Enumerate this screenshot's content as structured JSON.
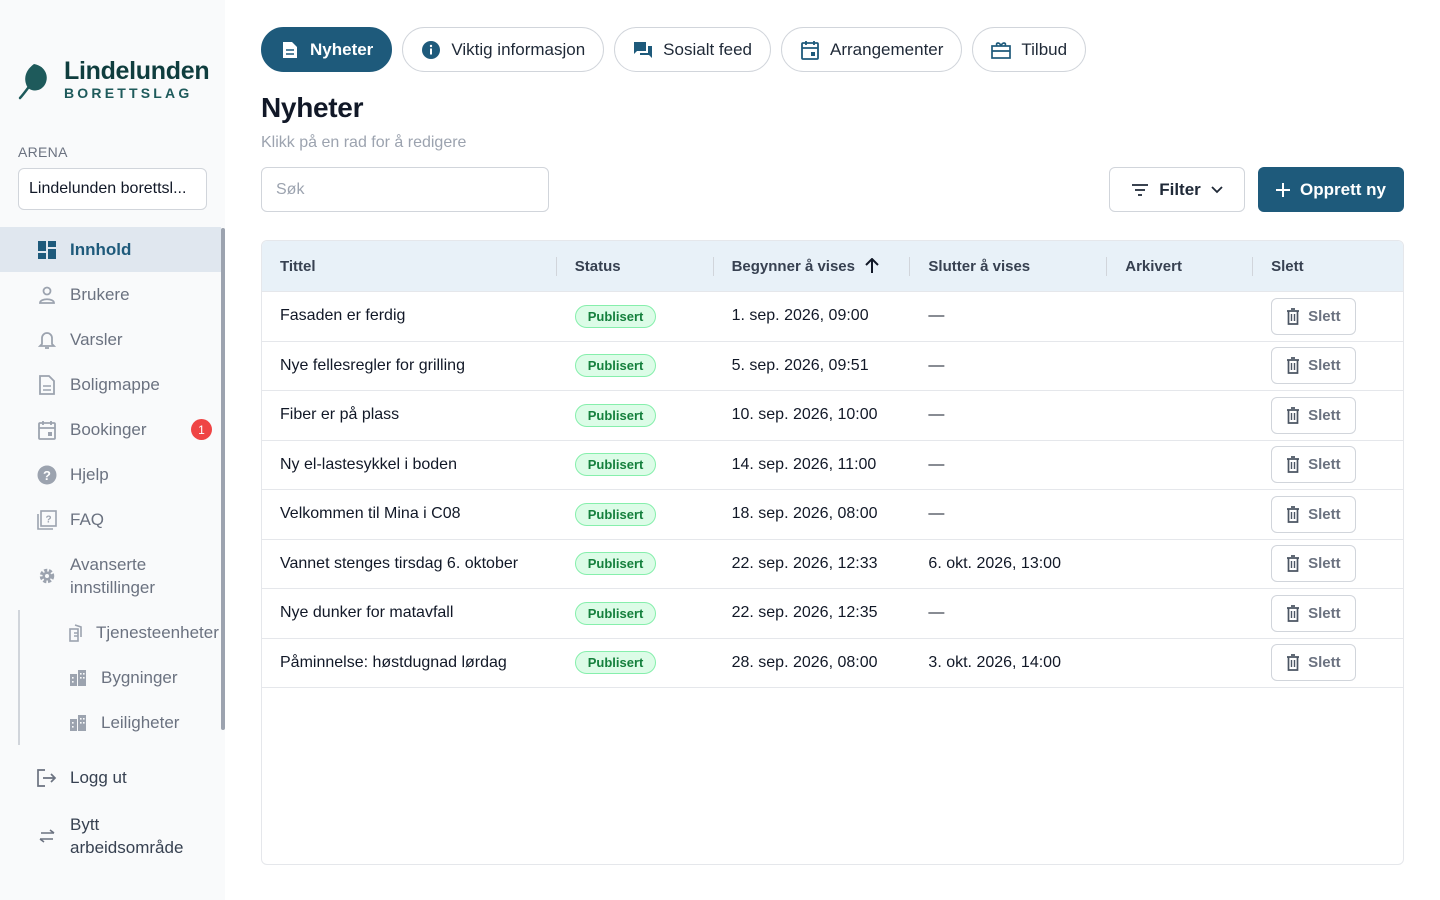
{
  "brand": {
    "name": "Lindelunden",
    "subtitle": "BORETTSLAG",
    "primary_color": "#1e5a7b"
  },
  "sidebar": {
    "arena_label": "ARENA",
    "arena_value": "Lindelunden borettsl...",
    "items": [
      {
        "label": "Innhold",
        "icon": "dashboard-icon",
        "active": true
      },
      {
        "label": "Brukere",
        "icon": "user-icon"
      },
      {
        "label": "Varsler",
        "icon": "bell-icon"
      },
      {
        "label": "Boligmappe",
        "icon": "document-icon"
      },
      {
        "label": "Bookinger",
        "icon": "calendar-icon",
        "badge": "1"
      },
      {
        "label": "Hjelp",
        "icon": "help-icon"
      },
      {
        "label": "FAQ",
        "icon": "faq-icon"
      },
      {
        "label": "Avanserte innstillinger",
        "icon": "gear-icon"
      }
    ],
    "sub_items": [
      {
        "label": "Tjenesteenheter",
        "icon": "device-icon"
      },
      {
        "label": "Bygninger",
        "icon": "building-icon"
      },
      {
        "label": "Leiligheter",
        "icon": "apartment-icon"
      }
    ],
    "logout": "Logg ut",
    "switch_workspace": "Bytt arbeidsområde"
  },
  "tabs": [
    {
      "label": "Nyheter",
      "icon": "article-icon",
      "active": true
    },
    {
      "label": "Viktig informasjon",
      "icon": "info-icon"
    },
    {
      "label": "Sosialt feed",
      "icon": "chat-icon"
    },
    {
      "label": "Arrangementer",
      "icon": "event-icon"
    },
    {
      "label": "Tilbud",
      "icon": "offer-icon"
    }
  ],
  "page": {
    "title": "Nyheter",
    "subtitle": "Klikk på en rad for å redigere"
  },
  "toolbar": {
    "search_placeholder": "Søk",
    "filter_label": "Filter",
    "create_label": "Opprett ny"
  },
  "table": {
    "columns": [
      "Tittel",
      "Status",
      "Begynner å vises",
      "Slutter å vises",
      "Arkivert",
      "Slett"
    ],
    "sorted_column": "Begynner å vises",
    "sort_direction": "ascending",
    "delete_label": "Slett",
    "rows": [
      {
        "title": "Fasaden er ferdig",
        "status": "Publisert",
        "start": "1. sep. 2026, 09:00",
        "end": "—",
        "archived": ""
      },
      {
        "title": "Nye fellesregler for grilling",
        "status": "Publisert",
        "start": "5. sep. 2026, 09:51",
        "end": "—",
        "archived": ""
      },
      {
        "title": "Fiber er på plass",
        "status": "Publisert",
        "start": "10. sep. 2026, 10:00",
        "end": "—",
        "archived": ""
      },
      {
        "title": "Ny el-lastesykkel i boden",
        "status": "Publisert",
        "start": "14. sep. 2026, 11:00",
        "end": "—",
        "archived": ""
      },
      {
        "title": "Velkommen til Mina i C08",
        "status": "Publisert",
        "start": "18. sep. 2026, 08:00",
        "end": "—",
        "archived": ""
      },
      {
        "title": "Vannet stenges tirsdag 6. oktober",
        "status": "Publisert",
        "start": "22. sep. 2026, 12:33",
        "end": "6. okt. 2026, 13:00",
        "archived": ""
      },
      {
        "title": "Nye dunker for matavfall",
        "status": "Publisert",
        "start": "22. sep. 2026, 12:35",
        "end": "—",
        "archived": ""
      },
      {
        "title": "Påminnelse: høstdugnad lørdag",
        "status": "Publisert",
        "start": "28. sep. 2026, 08:00",
        "end": "3. okt. 2026, 14:00",
        "archived": ""
      }
    ]
  }
}
